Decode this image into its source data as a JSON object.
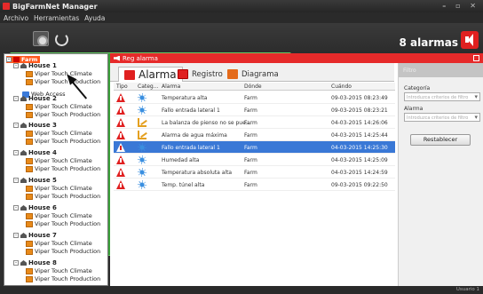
{
  "window": {
    "title": "BigFarmNet Manager",
    "controls": "– ▫ ✕"
  },
  "menu": [
    "Archivo",
    "Herramientas",
    "Ayuda"
  ],
  "header": {
    "alarm_count": "8 alarmas"
  },
  "tree": {
    "root": "Farm",
    "web_access": "Web Access",
    "houses": [
      {
        "name": "House 1",
        "children": [
          "Viper Touch Climate",
          "Viper Touch Production"
        ]
      },
      {
        "name": "House 2",
        "children": [
          "Viper Touch Climate",
          "Viper Touch Production"
        ]
      },
      {
        "name": "House 3",
        "children": [
          "Viper Touch Climate",
          "Viper Touch Production"
        ]
      },
      {
        "name": "House 4",
        "children": [
          "Viper Touch Climate",
          "Viper Touch Production"
        ]
      },
      {
        "name": "House 5",
        "children": [
          "Viper Touch Climate",
          "Viper Touch Production"
        ]
      },
      {
        "name": "House 6",
        "children": [
          "Viper Touch Climate",
          "Viper Touch Production"
        ]
      },
      {
        "name": "House 7",
        "children": [
          "Viper Touch Climate",
          "Viper Touch Production"
        ]
      },
      {
        "name": "House 8",
        "children": [
          "Viper Touch Climate",
          "Viper Touch Production"
        ]
      }
    ]
  },
  "panel": {
    "title": "Reg alarma",
    "tabs": [
      "Alarma",
      "Registro",
      "Diagrama"
    ],
    "active_tab": "Alarma"
  },
  "table": {
    "columns": [
      "Tipo",
      "Categ...",
      "Alarma",
      "Dónde",
      "Cuándo"
    ],
    "rows": [
      {
        "cat": "climate",
        "alarm": "Temperatura alta",
        "where": "Farm",
        "when": "09-03-2015 08:23:49",
        "selected": false
      },
      {
        "cat": "climate",
        "alarm": "Fallo entrada lateral 1",
        "where": "Farm",
        "when": "09-03-2015 08:23:21",
        "selected": false
      },
      {
        "cat": "production",
        "alarm": "La balanza de pienso no se pue...",
        "where": "Farm",
        "when": "04-03-2015 14:26:06",
        "selected": false
      },
      {
        "cat": "production",
        "alarm": "Alarma de agua máxima",
        "where": "Farm",
        "when": "04-03-2015 14:25:44",
        "selected": false
      },
      {
        "cat": "climate",
        "alarm": "Fallo entrada lateral 1",
        "where": "Farm",
        "when": "04-03-2015 14:25:30",
        "selected": true
      },
      {
        "cat": "climate",
        "alarm": "Humedad alta",
        "where": "Farm",
        "when": "04-03-2015 14:25:09",
        "selected": false
      },
      {
        "cat": "climate",
        "alarm": "Temperatura absoluta alta",
        "where": "Farm",
        "when": "04-03-2015 14:24:59",
        "selected": false
      },
      {
        "cat": "climate",
        "alarm": "Temp. túnel alta",
        "where": "Farm",
        "when": "09-03-2015 09:22:50",
        "selected": false
      }
    ]
  },
  "filter": {
    "title": "Filtro",
    "category_label": "Categoría",
    "category_placeholder": "Introduzca criterios de filtro",
    "alarm_label": "Alarma",
    "alarm_placeholder": "Introduzca criterios de filtro",
    "reset_button": "Restablecer"
  },
  "status": {
    "user": "Usuario 1"
  },
  "colors": {
    "accent": "#e62a2a",
    "tree_selected": "#ff5a1f",
    "row_selected": "#3a78d6"
  }
}
